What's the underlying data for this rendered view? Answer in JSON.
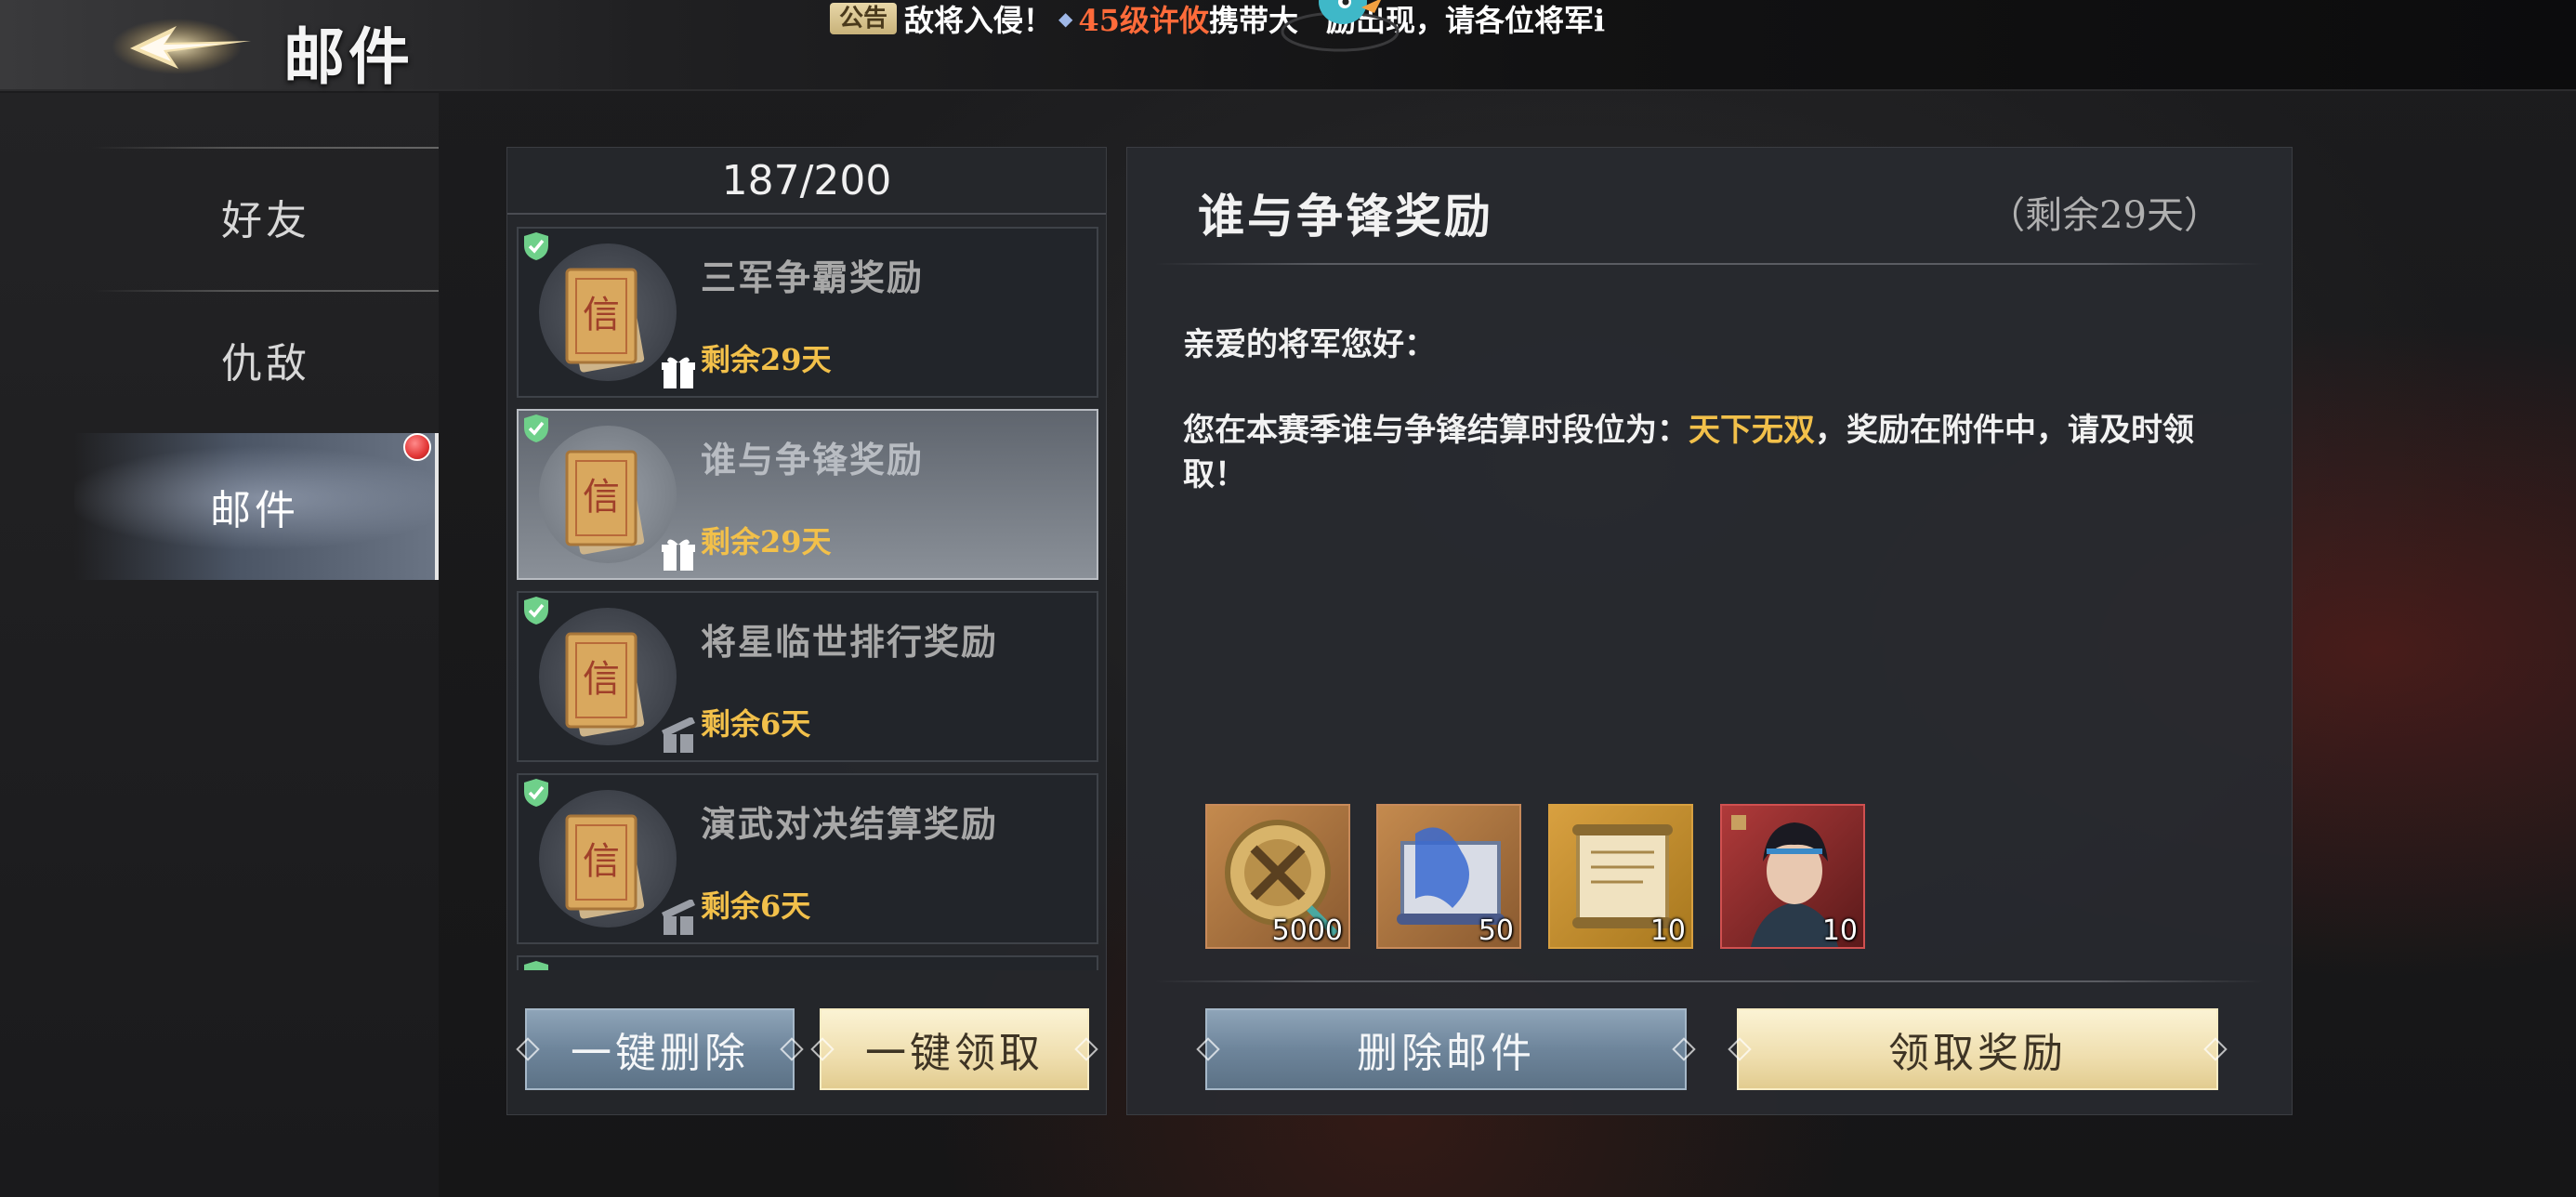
{
  "header": {
    "title": "邮件",
    "announcement": {
      "tag": "公告",
      "text1": "敌将入侵！",
      "highlight": "45级许攸",
      "text2": "携带大",
      "text3": "励出现，请各位将军i"
    }
  },
  "sidebar": {
    "items": [
      {
        "label": "好友"
      },
      {
        "label": "仇敌"
      },
      {
        "label": "邮件"
      }
    ]
  },
  "mail_list": {
    "count": "187/200",
    "items": [
      {
        "title": "三军争霸奖励",
        "days": "剩余29天"
      },
      {
        "title": "谁与争锋奖励",
        "days": "剩余29天"
      },
      {
        "title": "将星临世排行奖励",
        "days": "剩余6天"
      },
      {
        "title": "演武对决结算奖励",
        "days": "剩余6天"
      }
    ],
    "delete_all": "一键删除",
    "claim_all": "一键领取"
  },
  "detail": {
    "title": "谁与争锋奖励",
    "remain": "（剩余29天）",
    "greeting": "亲爱的将军您好：",
    "body_pre": "您在本赛季谁与争锋结算时段位为：",
    "body_rank": "天下无双",
    "body_post": "，奖励在附件中，请及时领取！",
    "attachments": [
      {
        "icon": "medal-icon",
        "count": "5000"
      },
      {
        "icon": "scroll-blue-icon",
        "count": "50"
      },
      {
        "icon": "scroll-gold-icon",
        "count": "10"
      },
      {
        "icon": "hero-portrait-icon",
        "count": "10"
      }
    ],
    "delete_button": "删除邮件",
    "claim_button": "领取奖励"
  },
  "colors": {
    "accent_gold": "#f2c04a",
    "announce_highlight": "#ff6b3a",
    "notify_red": "#e23636"
  }
}
